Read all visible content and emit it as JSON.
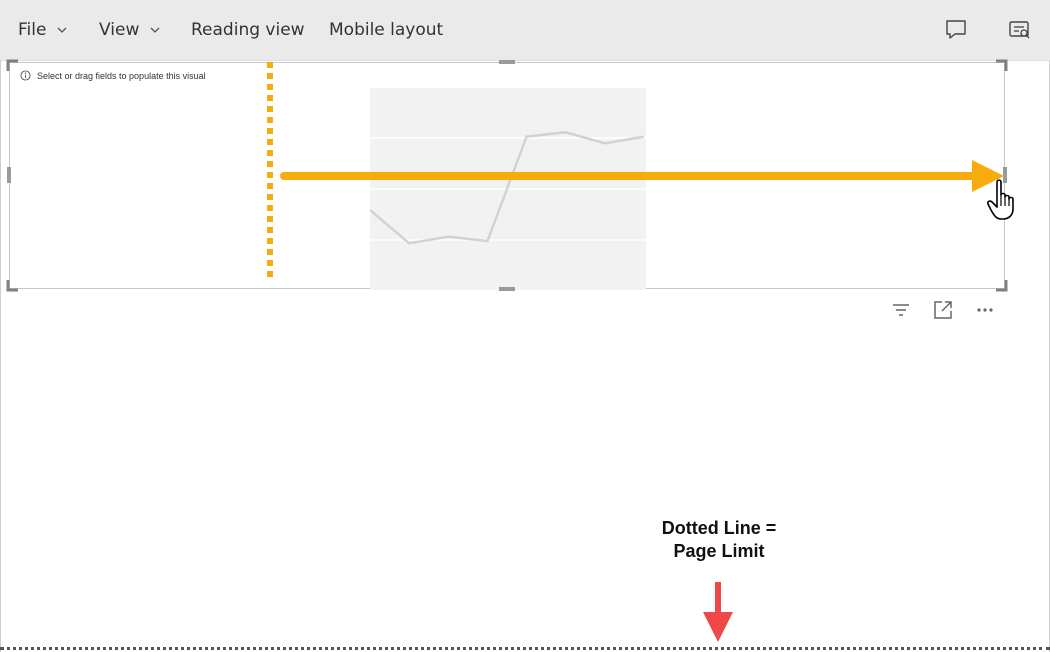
{
  "menubar": {
    "file_label": "File",
    "view_label": "View",
    "reading_view_label": "Reading view",
    "mobile_layout_label": "Mobile layout",
    "comment_icon": "comment-icon",
    "personalize_icon": "personalize-visual-icon"
  },
  "visual": {
    "hint_text": "Select or drag fields to populate this visual",
    "placeholder_chart": {
      "type": "line",
      "values": [
        45,
        30,
        33,
        31,
        78,
        80,
        75,
        78
      ]
    },
    "actions": [
      "filter-icon",
      "focus-mode-icon",
      "more-options-icon"
    ]
  },
  "annotation": {
    "line1": "Dotted Line =",
    "line2": "Page Limit"
  },
  "colors": {
    "accent_orange": "#F5AC0C",
    "arrow_red": "#F04848",
    "topbar_bg": "#EAEAEA"
  }
}
